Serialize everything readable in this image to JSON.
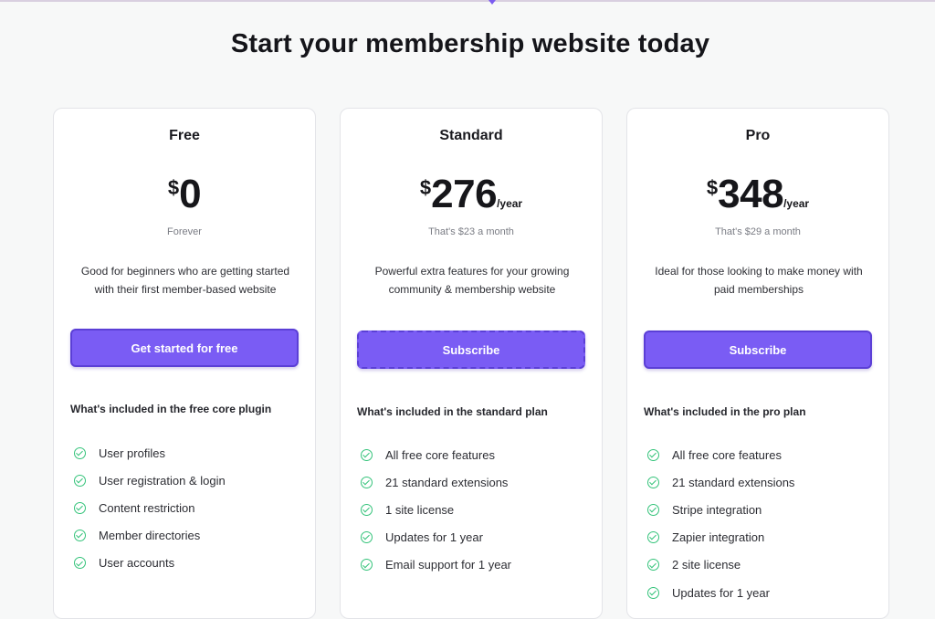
{
  "page": {
    "headline": "Start your membership website today",
    "accent_color": "#7a5cf4",
    "check_color": "#34c37a"
  },
  "plans": [
    {
      "name": "Free",
      "currency": "$",
      "price": "0",
      "period": "",
      "subprice": "Forever",
      "description": "Good for beginners who are getting started with their first member-based website",
      "cta": "Get started for free",
      "included_heading": "What's included in the free core plugin",
      "features": [
        "User profiles",
        "User registration & login",
        "Content restriction",
        "Member directories",
        "User accounts"
      ]
    },
    {
      "name": "Standard",
      "currency": "$",
      "price": "276",
      "period": "/year",
      "subprice": "That's $23 a month",
      "description": "Powerful extra features for your growing community & membership website",
      "cta": "Subscribe",
      "included_heading": "What's included in the standard plan",
      "features": [
        "All free core features",
        "21 standard extensions",
        "1 site license",
        "Updates for 1 year",
        "Email support for 1 year"
      ]
    },
    {
      "name": "Pro",
      "currency": "$",
      "price": "348",
      "period": "/year",
      "subprice": "That's $29 a month",
      "description": "Ideal for those looking to make money with paid memberships",
      "cta": "Subscribe",
      "included_heading": "What's included in the pro plan",
      "features": [
        "All free core features",
        "21 standard extensions",
        "Stripe integration",
        "Zapier integration",
        "2 site license",
        "Updates for 1 year"
      ]
    }
  ]
}
